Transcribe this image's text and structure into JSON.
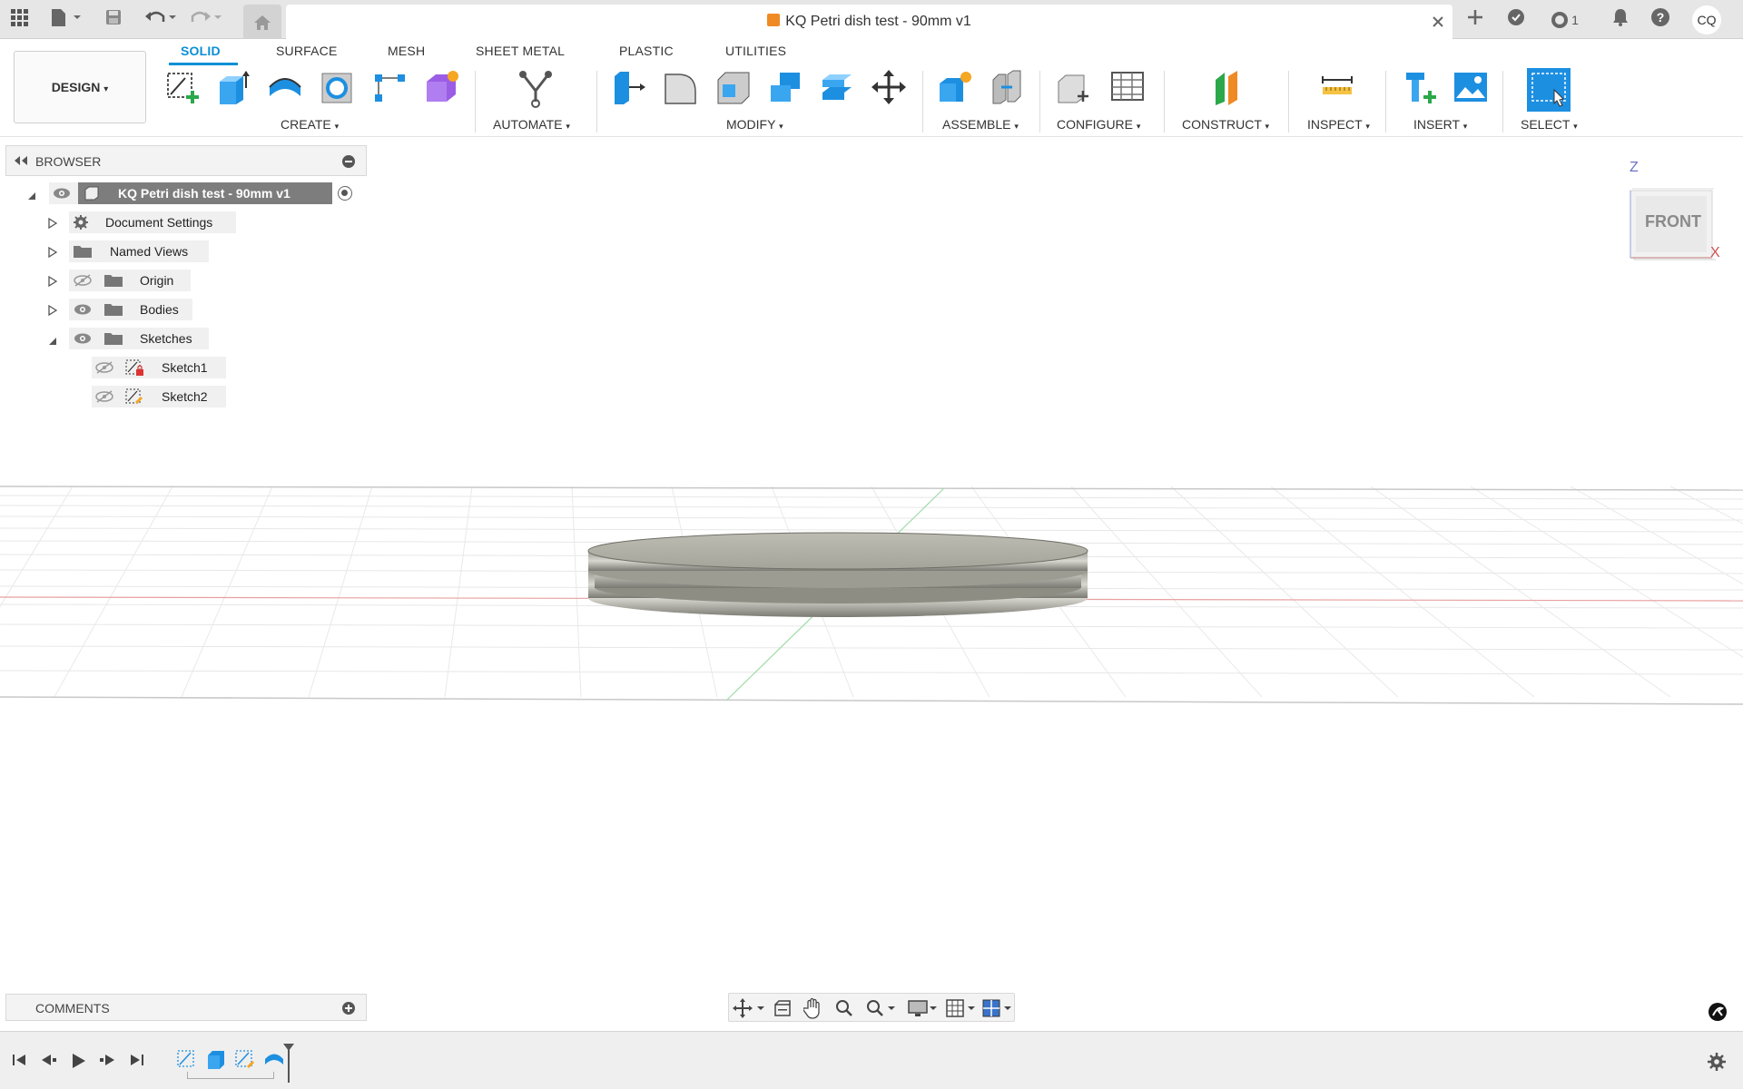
{
  "window": {
    "document_title": "KQ Petri dish test - 90mm v1",
    "notification_count": "1",
    "user_initials": "CQ"
  },
  "ribbon": {
    "workspace": "DESIGN",
    "tabs": [
      "SOLID",
      "SURFACE",
      "MESH",
      "SHEET METAL",
      "PLASTIC",
      "UTILITIES"
    ],
    "active_tab": "SOLID",
    "groups": {
      "create": "CREATE",
      "automate": "AUTOMATE",
      "modify": "MODIFY",
      "assemble": "ASSEMBLE",
      "configure": "CONFIGURE",
      "construct": "CONSTRUCT",
      "inspect": "INSPECT",
      "insert": "INSERT",
      "select": "SELECT"
    }
  },
  "browser": {
    "title": "BROWSER",
    "root": "KQ Petri dish test - 90mm v1",
    "items": [
      {
        "label": "Document Settings"
      },
      {
        "label": "Named Views"
      },
      {
        "label": "Origin"
      },
      {
        "label": "Bodies"
      },
      {
        "label": "Sketches"
      },
      {
        "label": "Sketch1"
      },
      {
        "label": "Sketch2"
      }
    ]
  },
  "viewcube": {
    "face": "FRONT",
    "axis_z": "Z",
    "axis_x": "X"
  },
  "comments": {
    "title": "COMMENTS"
  },
  "colors": {
    "accent": "#0a8fd6",
    "brand_orange": "#f08a24"
  }
}
